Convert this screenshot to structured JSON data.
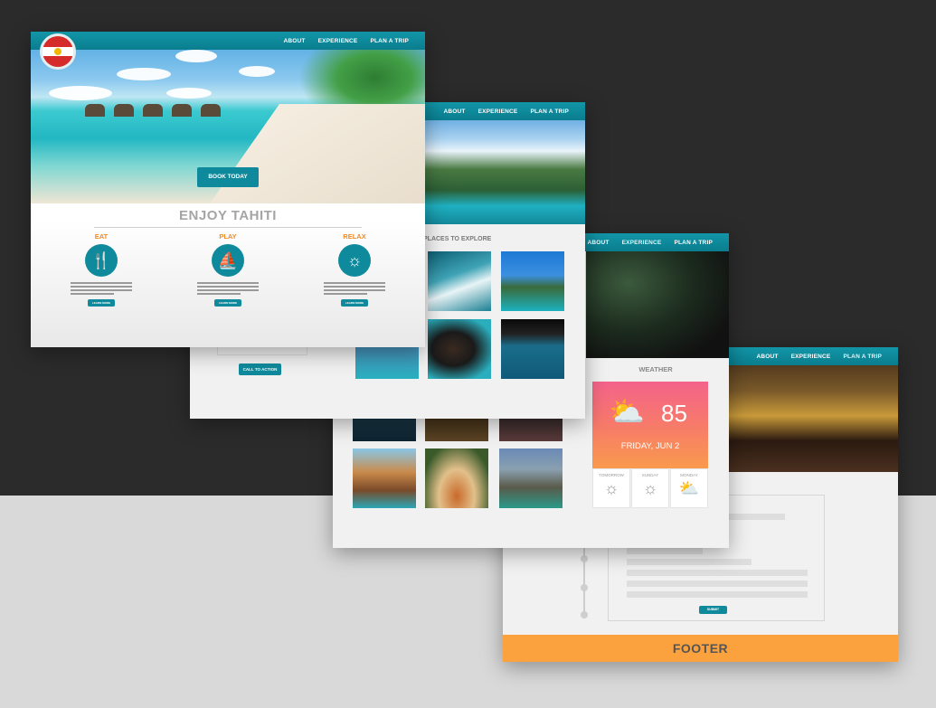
{
  "nav": {
    "about": "ABOUT",
    "experience": "EXPERIENCE",
    "plan": "PLAN A TRIP"
  },
  "home": {
    "book_label": "BOOK TODAY",
    "title": "ENJOY TAHITI",
    "features": [
      {
        "title": "EAT",
        "icon": "fork-knife-icon",
        "learn": "LEARN MORE"
      },
      {
        "title": "PLAY",
        "icon": "sailboat-icon",
        "learn": "LEARN MORE"
      },
      {
        "title": "RELAX",
        "icon": "sun-icon",
        "learn": "LEARN MORE"
      }
    ]
  },
  "experience": {
    "places_title": "PLACES TO EXPLORE",
    "cta_label": "CALL TO ACTION"
  },
  "weather": {
    "title": "WEATHER",
    "temp": "85",
    "date": "FRIDAY, JUN 2",
    "forecast": [
      {
        "day": "TOMORROW",
        "icon": "sun-icon"
      },
      {
        "day": "SUNDAY",
        "icon": "sun-icon"
      },
      {
        "day": "MONDAY",
        "icon": "partly-cloudy-icon"
      }
    ]
  },
  "plan": {
    "submit_label": "SUBMIT",
    "footer": "FOOTER"
  },
  "colors": {
    "primary": "#0f8a9c",
    "accent": "#f08a24",
    "footer": "#fba23e"
  }
}
